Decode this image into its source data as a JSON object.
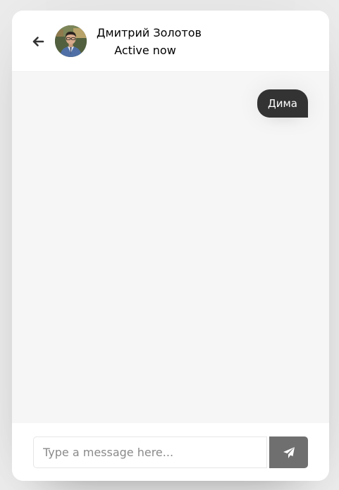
{
  "chat": {
    "user_name": "Дмитрий Золотов",
    "user_status": "Active now",
    "avatar_icon": "user-photo-icon",
    "messages": [
      {
        "direction": "outgoing",
        "text": "Дима"
      }
    ]
  },
  "composer": {
    "placeholder": "Type a message here...",
    "value": "",
    "send_icon": "paper-plane-icon"
  },
  "colors": {
    "outgoing_bubble": "#333333",
    "send_button": "#6f6f6f",
    "chat_background": "#f6f6f6"
  }
}
